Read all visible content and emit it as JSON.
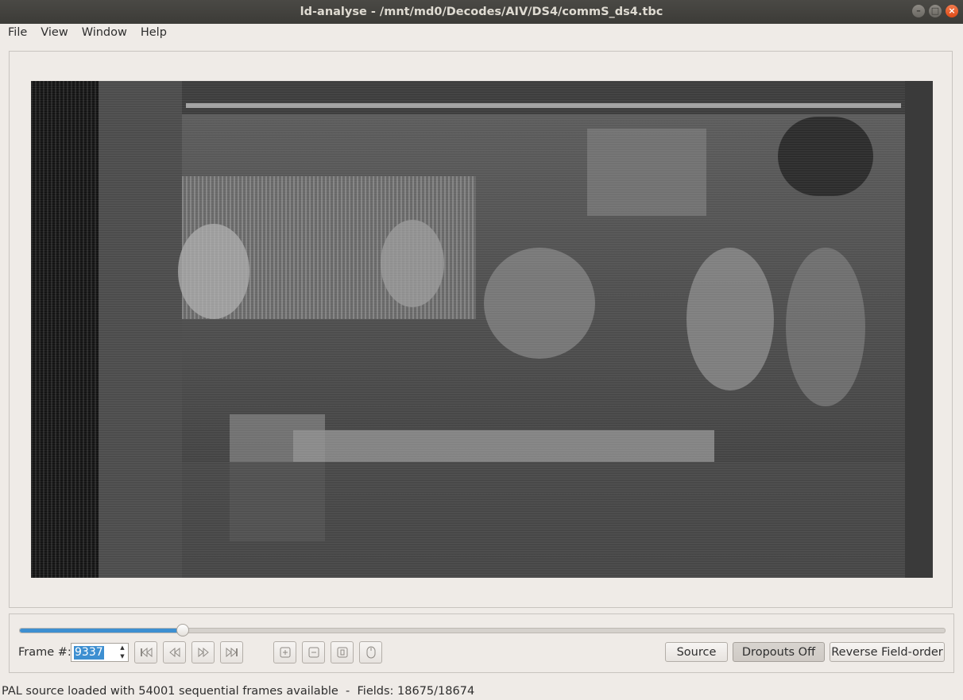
{
  "window": {
    "title": "ld-analyse - /mnt/md0/Decodes/AIV/DS4/commS_ds4.tbc",
    "controls": {
      "minimize_icon": "minus",
      "maximize_icon": "square",
      "close_icon": "x"
    }
  },
  "menubar": {
    "items": [
      {
        "label": "File"
      },
      {
        "label": "View"
      },
      {
        "label": "Window"
      },
      {
        "label": "Help"
      }
    ]
  },
  "video": {
    "content": "grayscale PAL video frame"
  },
  "controls": {
    "slider": {
      "value_fraction": 0.176
    },
    "frame_label": "Frame #:",
    "frame_value": "9337",
    "nav_buttons": [
      {
        "icon": "skip-to-start-icon"
      },
      {
        "icon": "rewind-icon"
      },
      {
        "icon": "fast-forward-icon"
      },
      {
        "icon": "skip-to-end-icon"
      }
    ],
    "tool_buttons": [
      {
        "icon": "zoom-in-icon"
      },
      {
        "icon": "zoom-out-icon"
      },
      {
        "icon": "original-size-icon"
      },
      {
        "icon": "mouse-icon"
      }
    ],
    "source_label": "Source",
    "dropouts_label": "Dropouts Off",
    "reverse_label": "Reverse Field-order"
  },
  "status": {
    "text": "PAL source loaded with 54001 sequential frames available  -  Fields: 18675/18674"
  }
}
